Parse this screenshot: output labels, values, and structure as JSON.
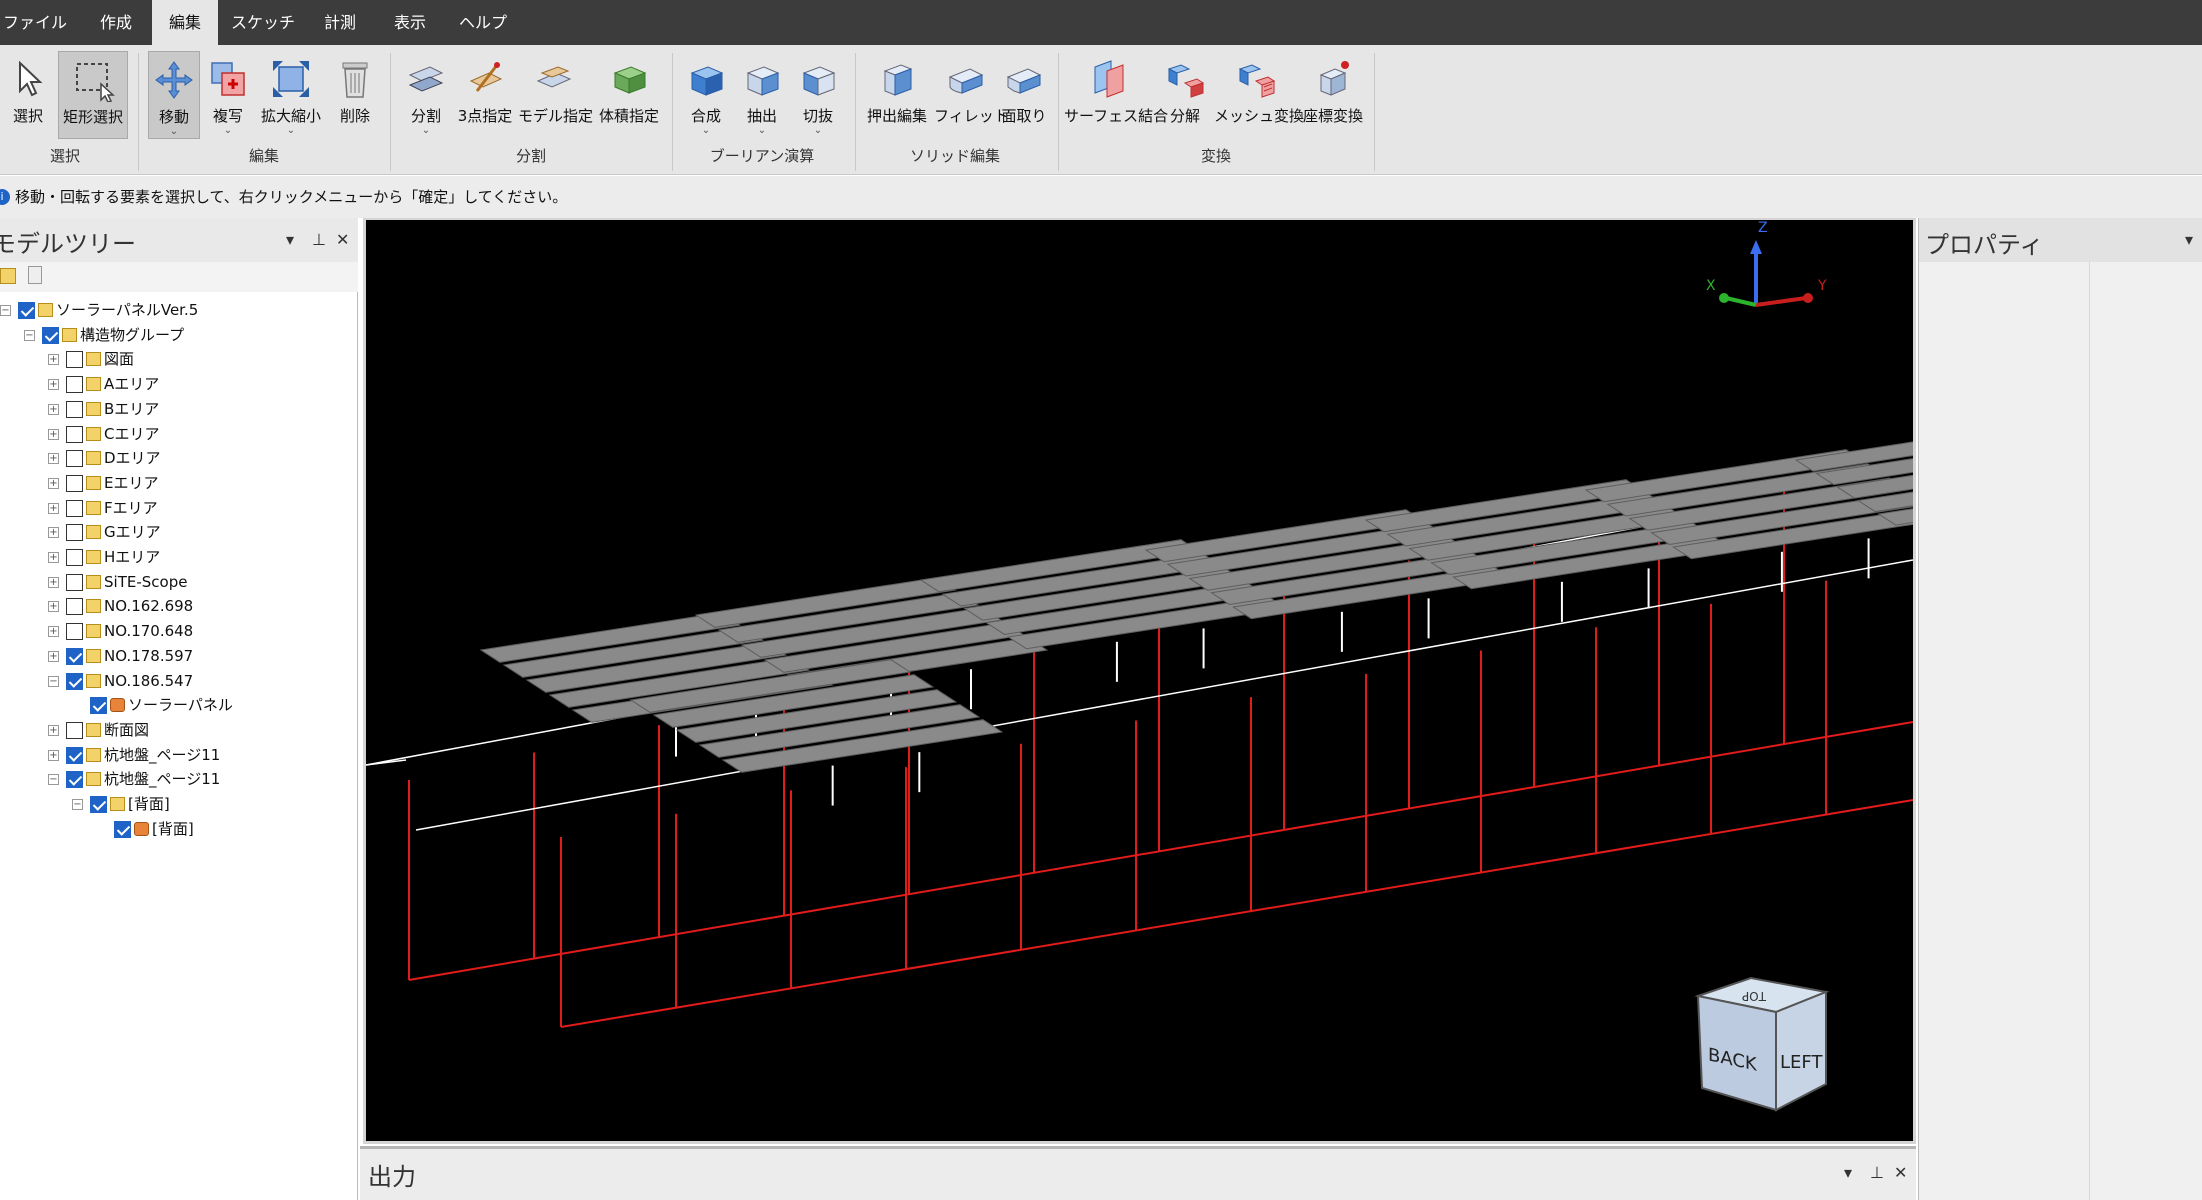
{
  "menubar": {
    "items": [
      {
        "label": "ファイル"
      },
      {
        "label": "作成"
      },
      {
        "label": "編集",
        "active": true
      },
      {
        "label": "スケッチ"
      },
      {
        "label": "計測"
      },
      {
        "label": "表示"
      },
      {
        "label": "ヘルプ"
      }
    ]
  },
  "ribbon": {
    "groups": [
      {
        "label": "選択"
      },
      {
        "label": "編集"
      },
      {
        "label": "分割"
      },
      {
        "label": "ブーリアン演算"
      },
      {
        "label": "ソリッド編集"
      },
      {
        "label": "変換"
      }
    ],
    "buttons": {
      "select": "選択",
      "rect_select": "矩形選択",
      "move": "移動",
      "copy": "複写",
      "scale": "拡大縮小",
      "delete": "削除",
      "split": "分割",
      "three_point": "3点指定",
      "model_spec": "モデル指定",
      "volume_spec": "体積指定",
      "union": "合成",
      "extract": "抽出",
      "cut": "切抜",
      "extrude_edit": "押出編集",
      "fillet": "フィレット",
      "chamfer": "面取り",
      "surface_join": "サーフェス結合",
      "decompose": "分解",
      "mesh_convert": "メッシュ変換",
      "coord_convert": "座標変換"
    }
  },
  "status": {
    "message": "移動・回転する要素を選択して、右クリックメニューから「確定」してください。"
  },
  "model_tree": {
    "title": "モデルツリー",
    "nodes": [
      {
        "label": "ソーラーパネルVer.5",
        "checked": true
      },
      {
        "label": "構造物グループ",
        "checked": true
      },
      {
        "label": "図面",
        "checked": false
      },
      {
        "label": "Aエリア",
        "checked": false
      },
      {
        "label": "Bエリア",
        "checked": false
      },
      {
        "label": "Cエリア",
        "checked": false
      },
      {
        "label": "Dエリア",
        "checked": false
      },
      {
        "label": "Eエリア",
        "checked": false
      },
      {
        "label": "Fエリア",
        "checked": false
      },
      {
        "label": "Gエリア",
        "checked": false
      },
      {
        "label": "Hエリア",
        "checked": false
      },
      {
        "label": "SiTE-Scope",
        "checked": false
      },
      {
        "label": "NO.162.698",
        "checked": false
      },
      {
        "label": "NO.170.648",
        "checked": false
      },
      {
        "label": "NO.178.597",
        "checked": true
      },
      {
        "label": "NO.186.547",
        "checked": true
      },
      {
        "label": "ソーラーパネル",
        "checked": true
      },
      {
        "label": "断面図",
        "checked": false
      },
      {
        "label": "杭地盤_ページ11",
        "checked": true
      },
      {
        "label": "杭地盤_ページ11",
        "checked": true
      },
      {
        "label": "[背面]",
        "checked": true
      },
      {
        "label": "[背面]",
        "checked": true
      }
    ]
  },
  "viewport": {
    "axes": {
      "x": "X",
      "y": "Y",
      "z": "Z"
    },
    "view_cube": {
      "top": "TOP",
      "back": "BACK",
      "left": "LEFT"
    },
    "colors": {
      "background": "#000000",
      "panel": "#8a8a8a",
      "grid_red": "#e21b1b",
      "rail_white": "#ffffff"
    }
  },
  "output_panel": {
    "title": "出力"
  },
  "properties_panel": {
    "title": "プロパティ"
  }
}
